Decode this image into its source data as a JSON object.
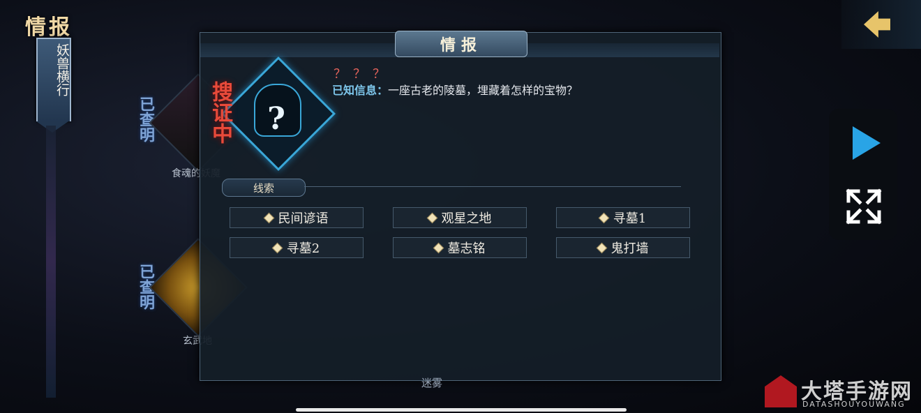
{
  "header": {
    "title": "情报"
  },
  "category": {
    "label": "妖兽横行"
  },
  "background_entries": [
    {
      "status": "已查明",
      "name": "食魂的妖魔"
    },
    {
      "status": "已查明",
      "name": "玄武地"
    }
  ],
  "panel": {
    "title": "情报",
    "status": "搜证中",
    "unknown_name": "？？？",
    "known_label": "已知信息：",
    "known_text": "一座古老的陵墓，埋藏着怎样的宝物？",
    "clues_tab": "线索",
    "clues": [
      "民间谚语",
      "观星之地",
      "寻墓1",
      "寻墓2",
      "墓志铭",
      "鬼打墙"
    ]
  },
  "bottom_label": "迷雾",
  "watermark": {
    "text": "大塔手游网",
    "sub": "DATASHOUYOUWANG"
  },
  "icons": {
    "back": "back-arrow-icon",
    "play": "play-icon",
    "expand": "expand-icon"
  }
}
